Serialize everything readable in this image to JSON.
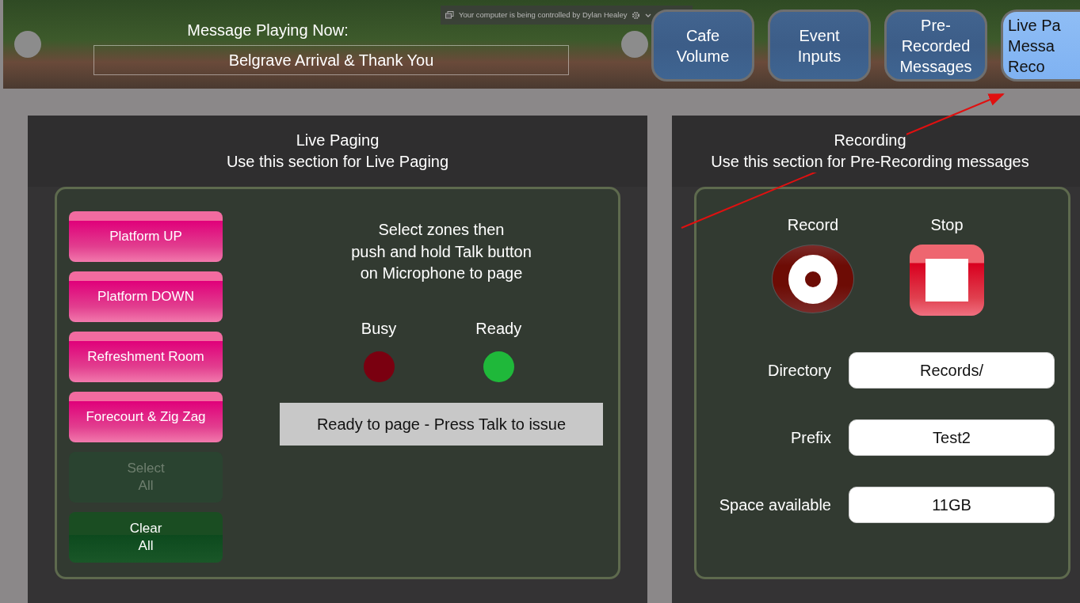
{
  "header": {
    "remote_notice": "Your computer is being controlled by Dylan Healey",
    "now_playing_label": "Message Playing Now:",
    "now_playing": "Belgrave Arrival & Thank You"
  },
  "tabs": [
    {
      "lines": [
        "Cafe",
        "Volume"
      ],
      "selected": false
    },
    {
      "lines": [
        "Event",
        "Inputs"
      ],
      "selected": false
    },
    {
      "lines": [
        "Pre-",
        "Recorded",
        "Messages"
      ],
      "selected": false
    },
    {
      "lines": [
        "Live Pa",
        "Messa",
        "Reco"
      ],
      "selected": true
    }
  ],
  "live_paging": {
    "title": "Live Paging",
    "subtitle": "Use this section for Live Paging",
    "zones": [
      {
        "label": "Platform UP",
        "kind": "zone",
        "disabled": false
      },
      {
        "label": "Platform DOWN",
        "kind": "zone",
        "disabled": false
      },
      {
        "label": "Refreshment Room",
        "kind": "zone",
        "disabled": false
      },
      {
        "label": "Forecourt & Zig Zag",
        "kind": "zone",
        "disabled": false
      },
      {
        "label": "Select\nAll",
        "kind": "action",
        "disabled": true
      },
      {
        "label": "Clear\nAll",
        "kind": "action",
        "disabled": false
      }
    ],
    "instructions": [
      "Select zones then",
      "push and hold Talk button",
      "on Microphone to page"
    ],
    "indicators": [
      {
        "label": "Busy",
        "color": "#7a0010"
      },
      {
        "label": "Ready",
        "color": "#1fb83a"
      }
    ],
    "status": "Ready to page - Press Talk to issue"
  },
  "recording": {
    "title": "Recording",
    "subtitle": "Use this section for Pre-Recording messages",
    "controls": [
      {
        "label": "Record",
        "kind": "record"
      },
      {
        "label": "Stop",
        "kind": "stop"
      }
    ],
    "fields": [
      {
        "label": "Directory",
        "value": "Records/"
      },
      {
        "label": "Prefix",
        "value": "Test2"
      },
      {
        "label": "Space available",
        "value": "11GB"
      }
    ]
  }
}
